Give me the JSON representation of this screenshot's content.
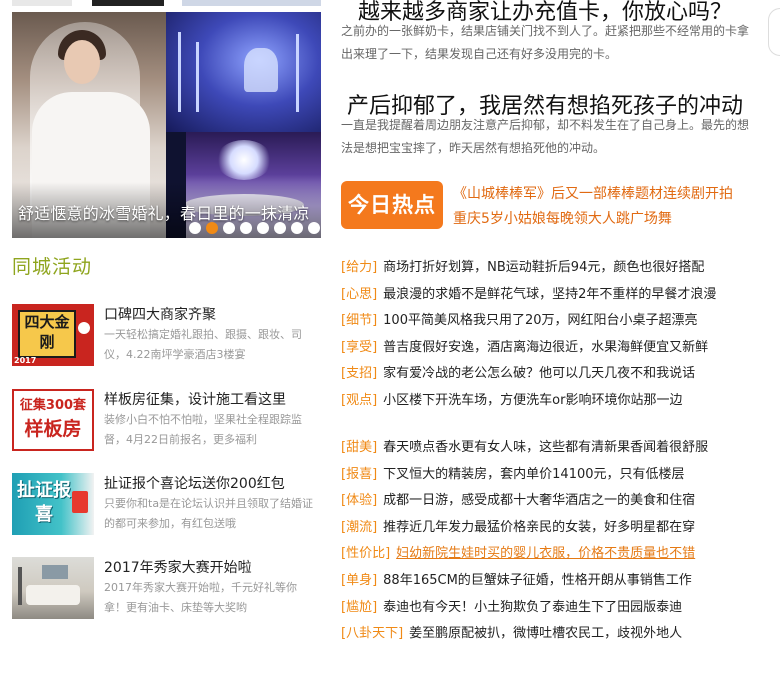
{
  "slideshow": {
    "caption": "舒适惬意的冰雪婚礼，春日里的一抹清凉",
    "dot_count": 8,
    "active_dot": 2
  },
  "activities": {
    "title": "同城活动",
    "items": [
      {
        "title": "口碑四大商家齐聚",
        "desc": "一天轻松搞定婚礼跟拍、跟摄、跟妆、司仪，4.22南坪学豪酒店3楼宴",
        "thumb_text": "四大金刚",
        "thumb_year": "2017"
      },
      {
        "title": "样板房征集，设计施工看这里",
        "desc": "装修小白不怕不怕啦，坚果社全程跟踪监督，4月22日前报名，更多福利",
        "thumb_line1": "征集300套",
        "thumb_line2": "样板房"
      },
      {
        "title": "扯证报个喜论坛送你200红包",
        "desc": "只要你和ta是在论坛认识并且领取了结婚证的都可来参加，有红包送哦",
        "thumb_text": "扯证报喜"
      },
      {
        "title": "2017年秀家大赛开始啦",
        "desc": "2017年秀家大赛开始啦，千元好礼等你拿！更有油卡、床垫等大奖哟"
      }
    ]
  },
  "articles": [
    {
      "title": "越来越多商家让办充值卡，你放心吗？",
      "body": "之前办的一张鲜奶卡，结果店铺关门找不到人了。赶紧把那些不经常用的卡拿出来理了一下，结果发现自己还有好多没用完的卡。"
    },
    {
      "title": "产后抑郁了，我居然有想掐死孩子的冲动",
      "body": "一直是我提醒着周边朋友注意产后抑郁，却不料发生在了自己身上。最先的想法是想把宝宝摔了，昨天居然有想掐死他的冲动。"
    }
  ],
  "hot_today": {
    "badge": "今日热点",
    "lines": [
      "《山城棒棒军》后又一部棒棒题材连续剧开拍",
      "重庆5岁小姑娘每晚领大人跳广场舞"
    ]
  },
  "news_group1": [
    {
      "tag": "[给力]",
      "text": "商场打折好划算，NB运动鞋折后94元，颜色也很好搭配"
    },
    {
      "tag": "[心思]",
      "text": "最浪漫的求婚不是鲜花气球，坚持2年不重样的早餐才浪漫"
    },
    {
      "tag": "[细节]",
      "text": "100平简美风格我只用了20万，网红阳台小桌子超漂亮"
    },
    {
      "tag": "[享受]",
      "text": "普吉度假好安逸，酒店离海边很近，水果海鲜便宜又新鲜"
    },
    {
      "tag": "[支招]",
      "text": "家有爱冷战的老公怎么破？他可以几天几夜不和我说话"
    },
    {
      "tag": "[观点]",
      "text": "小区楼下开洗车场，方便洗车or影响环境你站那一边"
    }
  ],
  "news_group2": [
    {
      "tag": "[甜美]",
      "text": "春天喷点香水更有女人味，这些都有清新果香闻着很舒服"
    },
    {
      "tag": "[报喜]",
      "text": "下叉恒大的精装房，套内单价14100元，只有低楼层"
    },
    {
      "tag": "[体验]",
      "text": "成都一日游，感受成都十大奢华酒店之一的美食和住宿"
    },
    {
      "tag": "[潮流]",
      "text": "推荐近几年发力最猛价格亲民的女装，好多明星都在穿"
    },
    {
      "tag": "[性价比]",
      "text": "妇幼新院生娃时买的婴儿衣服，价格不贵质量也不错"
    },
    {
      "tag": "[单身]",
      "text": "88年165CM的巨蟹妹子征婚，性格开朗从事销售工作"
    },
    {
      "tag": "[尴尬]",
      "text": "泰迪也有今天！小土狗欺负了泰迪生下了田园版泰迪"
    },
    {
      "tag": "[八卦天下]",
      "text": "姜至鹏原配被扒，微博吐槽农民工，歧视外地人"
    }
  ],
  "colors": {
    "accent_orange": "#f4791d",
    "tag_orange": "#f08a16",
    "section_green": "#8fa51e"
  }
}
